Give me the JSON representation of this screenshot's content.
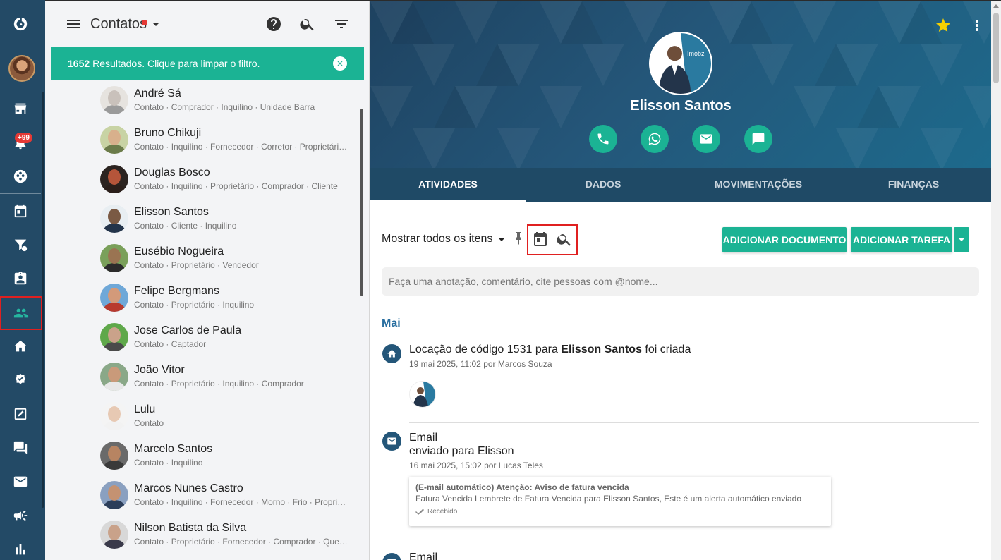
{
  "rail": {
    "badge": "+99",
    "items": [
      "logo",
      "avatar",
      "store",
      "notifications",
      "dashboard",
      "calendar",
      "sales-funnel",
      "clipboard",
      "contacts",
      "properties",
      "approvals",
      "tasks",
      "chat",
      "email",
      "campaigns",
      "reports"
    ]
  },
  "contacts_panel": {
    "title": "Contatos",
    "filter_count": "1652",
    "filter_text": "Resultados. Clique para limpar o filtro.",
    "items": [
      {
        "name": "André Sá",
        "tags": "Contato · Comprador · Inquilino · Unidade Barra",
        "skin": "#c9c1bb",
        "shirt": "#9a9a9a",
        "bg": "#e6e3df"
      },
      {
        "name": "Bruno Chikuji",
        "tags": "Contato · Inquilino · Fornecedor · Corretor · Proprietário · ...",
        "skin": "#d8b08c",
        "shirt": "#6b7b4a",
        "bg": "#c8d3a4"
      },
      {
        "name": "Douglas Bosco",
        "tags": "Contato · Inquilino · Proprietário · Comprador · Cliente",
        "skin": "#b5553a",
        "shirt": "#2a1e1a",
        "bg": "#2b2320"
      },
      {
        "name": "Elisson Santos",
        "tags": "Contato · Cliente · Inquilino",
        "skin": "#7a5a44",
        "shirt": "#23344a",
        "bg": "#e8eef2"
      },
      {
        "name": "Eusébio Nogueira",
        "tags": "Contato · Proprietário · Vendedor",
        "skin": "#9a7452",
        "shirt": "#2b2b2b",
        "bg": "#7aa05a"
      },
      {
        "name": "Felipe Bergmans",
        "tags": "Contato · Proprietário · Inquilino",
        "skin": "#d39a7a",
        "shirt": "#b83a2e",
        "bg": "#6fa8d8"
      },
      {
        "name": "Jose Carlos de Paula",
        "tags": "Contato · Captador",
        "skin": "#caa28a",
        "shirt": "#4a4a4a",
        "bg": "#5fa84a"
      },
      {
        "name": "João Vitor",
        "tags": "Contato · Proprietário · Inquilino · Comprador",
        "skin": "#c99a7a",
        "shirt": "#e8e8e8",
        "bg": "#8aa888"
      },
      {
        "name": "Lulu",
        "tags": "Contato",
        "skin": "#e7c9b3",
        "shirt": "#f2f2f2",
        "bg": "#f4f4f4"
      },
      {
        "name": "Marcelo Santos",
        "tags": "Contato · Inquilino",
        "skin": "#b78462",
        "shirt": "#3a3a3a",
        "bg": "#6a6a6a"
      },
      {
        "name": "Marcos Nunes Castro",
        "tags": "Contato · Inquilino · Fornecedor · Morno · Frio · Proprietári...",
        "skin": "#c49272",
        "shirt": "#2c3e5a",
        "bg": "#8aa0c0"
      },
      {
        "name": "Nilson Batista da Silva",
        "tags": "Contato · Proprietário · Fornecedor · Comprador · Quente ...",
        "skin": "#c9a28a",
        "shirt": "#3a3a4a",
        "bg": "#d8d8d8"
      }
    ]
  },
  "profile": {
    "name": "Elisson Santos",
    "avatar_brand": "Imobzi",
    "star_color": "#f5d000"
  },
  "tabs": [
    "ATIVIDADES",
    "DADOS",
    "MOVIMENTAÇÕES",
    "FINANÇAS"
  ],
  "toolbar": {
    "filter_label": "Mostrar todos os itens",
    "btn_document": "ADICIONAR DOCUMENTO",
    "btn_task": "ADICIONAR TAREFA"
  },
  "note_placeholder": "Faça uma anotação, comentário, cite pessoas com @nome...",
  "timeline": {
    "month": "Mai",
    "entries": [
      {
        "title_pre": "Locação de código 1531 para ",
        "title_bold": "Elisson Santos",
        "title_post": " foi criada",
        "meta": "19 mai 2025, 11:02 por Marcos Souza"
      },
      {
        "title_line1": "Email",
        "title_line2": "enviado para Elisson",
        "meta": "16 mai 2025, 15:02 por Lucas Teles",
        "email_subject": "(E-mail automático) Atenção: Aviso de fatura vencida",
        "email_body": "Fatura Vencida Lembrete de Fatura Vencida para Elisson Santos, Este é um alerta automático enviado",
        "email_status": "Recebido"
      },
      {
        "title_line1": "Email"
      }
    ]
  },
  "colors": {
    "accent": "#1bb394",
    "rail_bg": "#234a66",
    "tabs_bg": "#1f4a66",
    "highlight": "#e02020"
  }
}
